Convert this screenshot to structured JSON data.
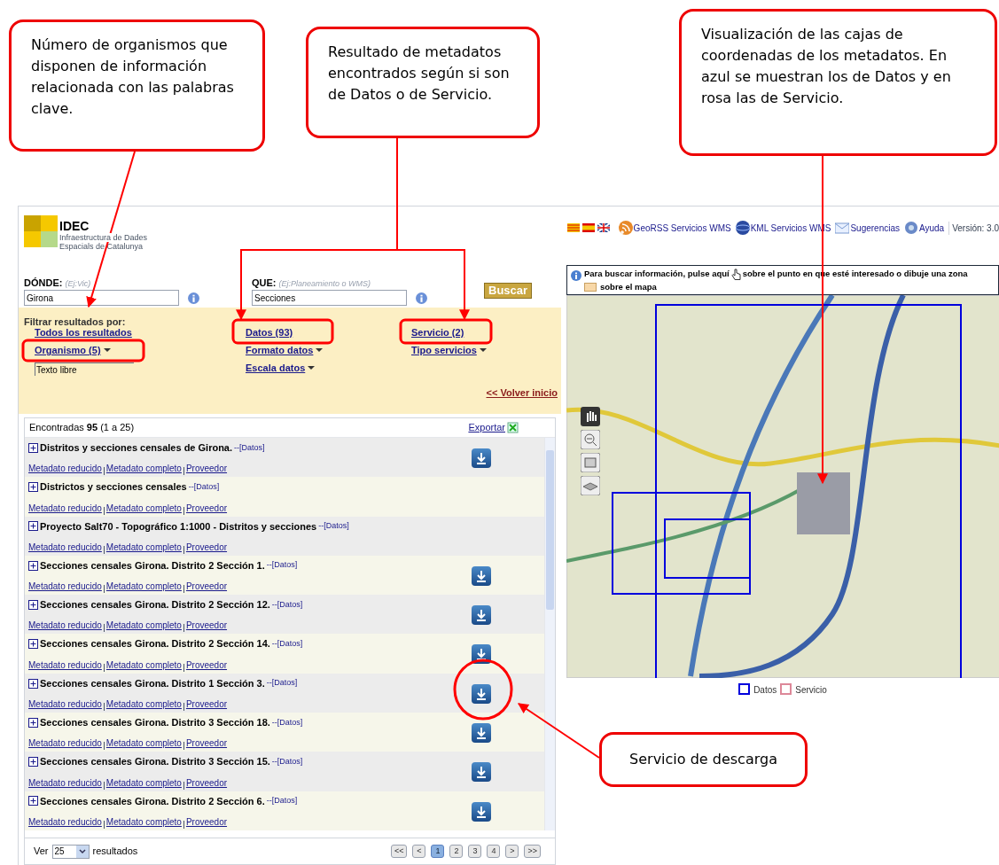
{
  "callouts": [
    {
      "text": "Número de organismos que disponen de información relacionada con las palabras clave."
    },
    {
      "text": "Resultado de metadatos encontrados según si son de Datos o de Servicio."
    },
    {
      "text": "Visualización de las cajas de coordenadas de los metadatos. En azul se muestran los de Datos y en rosa las de Servicio."
    },
    {
      "text": "Servicio de descarga"
    }
  ],
  "header": {
    "logo_title": "IDEC",
    "logo_subtitle": [
      "Infraestructura de Dades",
      "Espacials de Catalunya"
    ],
    "links": [
      {
        "kind": "rss",
        "label": "GeoRSS Servicios WMS"
      },
      {
        "kind": "globe",
        "label": "KML Servicios WMS"
      },
      {
        "kind": "mail",
        "label": "Sugerencias"
      },
      {
        "kind": "help",
        "label": "Ayuda"
      }
    ],
    "version": "Versión: 3.0"
  },
  "search": {
    "fields": [
      {
        "label": "DÓNDE:",
        "hint": "(Ej:Vic)",
        "value": "Girona"
      },
      {
        "label": "QUE:",
        "hint": "(Ej:Planeamiento o WMS)",
        "value": "Secciones"
      }
    ],
    "button": "Buscar"
  },
  "filters": {
    "title": "Filtrar resultados por:",
    "columns": [
      [
        {
          "label": "Todos los resultados",
          "dropdown": false
        },
        {
          "label": "Organismo (5)",
          "dropdown": true
        }
      ],
      [
        {
          "label": "Datos (93)",
          "dropdown": false
        },
        {
          "label": "Formato datos",
          "dropdown": true
        },
        {
          "label": "Escala datos",
          "dropdown": true
        }
      ],
      [
        {
          "label": "Servicio (2)",
          "dropdown": false
        },
        {
          "label": "Tipo servicios",
          "dropdown": true
        }
      ]
    ],
    "free_text": "Texto libre",
    "back": "<< Volver inicio"
  },
  "results": {
    "summary": "Encontradas **95** (1 a 25)",
    "export": "Exportar",
    "items": [
      {
        "title": "Distritos y secciones censales de Girona.",
        "type": "--[Datos]",
        "download": true,
        "links": [
          "Metadato reducido",
          "Metadato completo",
          "Proveedor"
        ]
      },
      {
        "title": "Districtos y secciones censales",
        "type": "--[Datos]",
        "download": false,
        "links": [
          "Metadato reducido",
          "Metadato completo",
          "Proveedor"
        ]
      },
      {
        "title": "Proyecto Salt70 - Topográfico 1:1000 - Distritos y secciones",
        "type": "--[Datos]",
        "download": false,
        "links": [
          "Metadato reducido",
          "Metadato completo",
          "Proveedor"
        ]
      },
      {
        "title": "Secciones censales Girona. Distrito 2 Sección 1.",
        "type": "--[Datos]",
        "download": true,
        "links": [
          "Metadato reducido",
          "Metadato completo",
          "Proveedor"
        ]
      },
      {
        "title": "Secciones censales Girona. Distrito 2 Sección 12.",
        "type": "--[Datos]",
        "download": true,
        "links": [
          "Metadato reducido",
          "Metadato completo",
          "Proveedor"
        ]
      },
      {
        "title": "Secciones censales Girona. Distrito 2 Sección 14.",
        "type": "--[Datos]",
        "download": true,
        "links": [
          "Metadato reducido",
          "Metadato completo",
          "Proveedor"
        ]
      },
      {
        "title": "Secciones censales Girona. Distrito 1 Sección 3.",
        "type": "--[Datos]",
        "download": true,
        "links": [
          "Metadato reducido",
          "Metadato completo",
          "Proveedor"
        ]
      },
      {
        "title": "Secciones censales Girona. Distrito 3 Sección 18.",
        "type": "--[Datos]",
        "download": true,
        "links": [
          "Metadato reducido",
          "Metadato completo",
          "Proveedor"
        ]
      },
      {
        "title": "Secciones censales Girona. Distrito 3 Sección 15.",
        "type": "--[Datos]",
        "download": true,
        "links": [
          "Metadato reducido",
          "Metadato completo",
          "Proveedor"
        ]
      },
      {
        "title": "Secciones censales Girona. Distrito 2 Sección 6.",
        "type": "--[Datos]",
        "download": true,
        "links": [
          "Metadato reducido",
          "Metadato completo",
          "Proveedor"
        ]
      }
    ],
    "pager": {
      "show_label": "Ver",
      "per_page": "25",
      "results_label": "resultados",
      "pages": [
        {
          "label": "<<",
          "selected": false
        },
        {
          "label": "<",
          "selected": false
        },
        {
          "label": "1",
          "selected": true
        },
        {
          "label": "2",
          "selected": false
        },
        {
          "label": "3",
          "selected": false
        },
        {
          "label": "4",
          "selected": false
        },
        {
          "label": ">",
          "selected": false
        },
        {
          "label": ">>",
          "selected": false
        }
      ]
    }
  },
  "map": {
    "info": [
      "Para buscar información, pulse aquí",
      "sobre el punto en que esté interesado o dibuje una zona",
      "sobre el mapa"
    ],
    "legend": [
      {
        "label": "Datos",
        "color": "#0000dd"
      },
      {
        "label": "Servicio",
        "color": "#dd8899"
      }
    ]
  }
}
